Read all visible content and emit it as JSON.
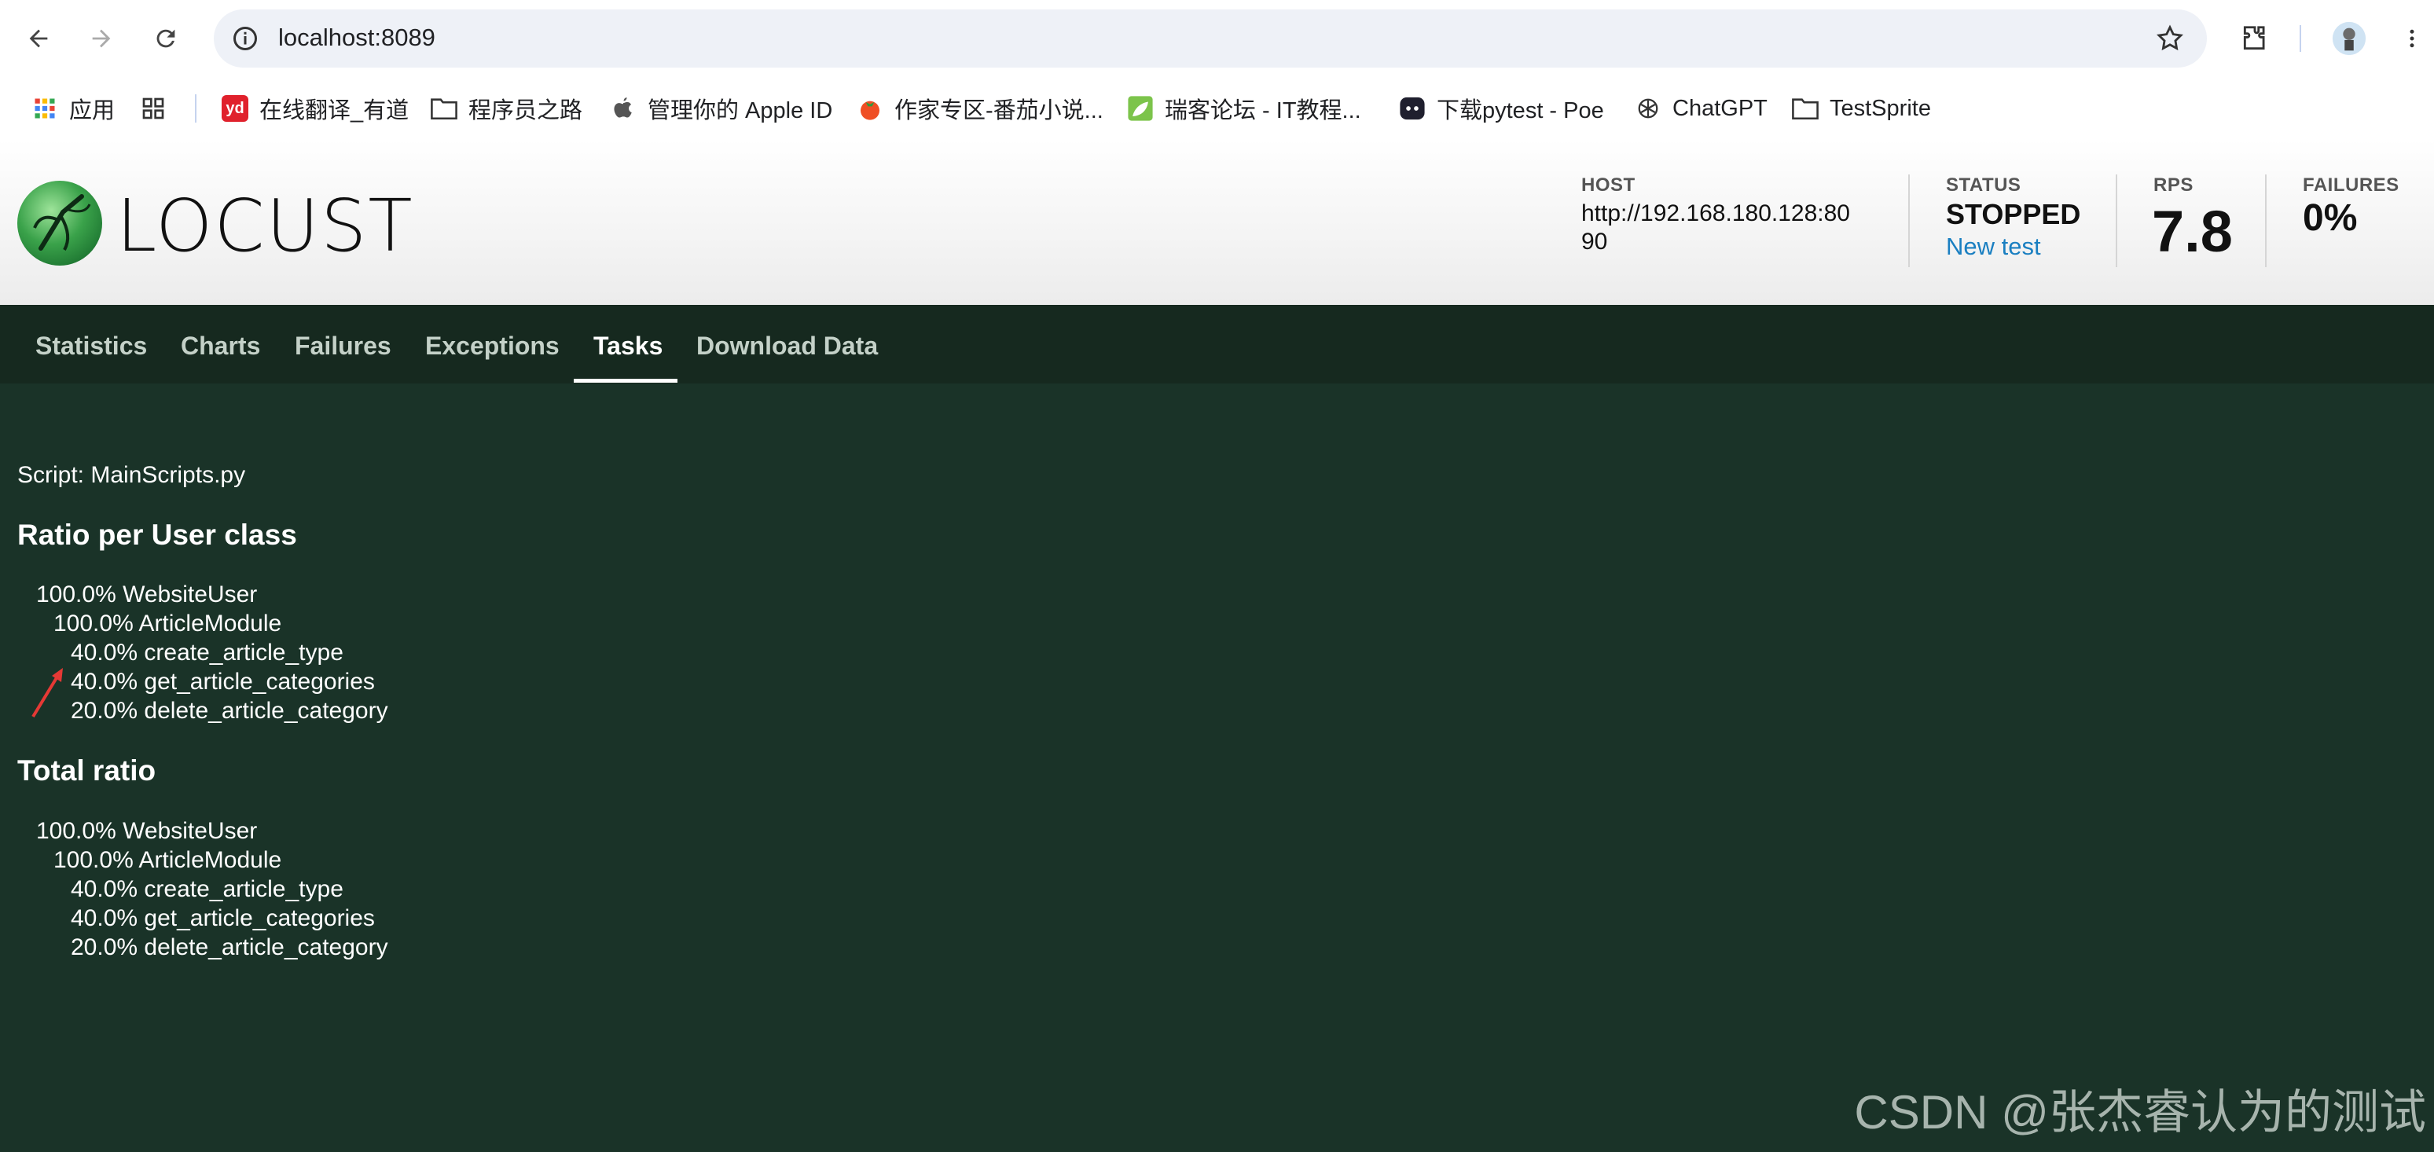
{
  "browser": {
    "url": "localhost:8089",
    "bookmarks": [
      {
        "label": "应用",
        "icon": "apps-grid-icon"
      },
      {
        "label": "",
        "icon": "tab-groups-icon"
      },
      {
        "label": "在线翻译_有道",
        "icon": "youdao-icon"
      },
      {
        "label": "程序员之路",
        "icon": "folder-icon"
      },
      {
        "label": "管理你的 Apple ID",
        "icon": "apple-icon"
      },
      {
        "label": "作家专区-番茄小说...",
        "icon": "tomato-icon"
      },
      {
        "label": "瑞客论坛 - IT教程...",
        "icon": "leaf-icon"
      },
      {
        "label": "下载pytest - Poe",
        "icon": "poe-icon"
      },
      {
        "label": "ChatGPT",
        "icon": "chatgpt-icon"
      },
      {
        "label": "TestSprite",
        "icon": "folder-icon"
      }
    ]
  },
  "header": {
    "logo_text": "LOCUST",
    "host_label": "HOST",
    "host_value_line1": "http://192.168.180.128:80",
    "host_value_line2": "90",
    "status_label": "STATUS",
    "status_value": "STOPPED",
    "new_test_label": "New test",
    "rps_label": "RPS",
    "rps_value": "7.8",
    "failures_label": "FAILURES",
    "failures_value": "0%"
  },
  "tabs": [
    "Statistics",
    "Charts",
    "Failures",
    "Exceptions",
    "Tasks",
    "Download Data"
  ],
  "active_tab": "Tasks",
  "tasks": {
    "script": "Script: MainScripts.py",
    "ratio_title": "Ratio per User class",
    "ratio_lines": [
      "100.0% WebsiteUser",
      "100.0% ArticleModule",
      "40.0% create_article_type",
      "40.0% get_article_categories",
      "20.0% delete_article_category"
    ],
    "total_title": "Total ratio",
    "total_lines": [
      "100.0% WebsiteUser",
      "100.0% ArticleModule",
      "40.0% create_article_type",
      "40.0% get_article_categories",
      "20.0% delete_article_category"
    ]
  },
  "watermark": "CSDN @张杰睿认为的测试",
  "colors": {
    "page_bg": "#1a3328",
    "tab_bar_bg": "#16291f",
    "link": "#1a7fc1",
    "annotation_arrow": "#e53935"
  }
}
